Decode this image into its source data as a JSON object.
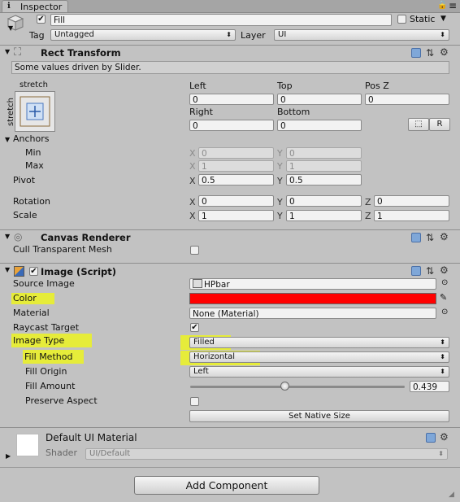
{
  "tab": {
    "label": "Inspector"
  },
  "gameobject": {
    "active": true,
    "name": "Fill",
    "static_label": "Static",
    "tag_label": "Tag",
    "tag_value": "Untagged",
    "layer_label": "Layer",
    "layer_value": "UI"
  },
  "rect_transform": {
    "title": "Rect Transform",
    "driven_note": "Some values driven by Slider.",
    "anchor_preset_top": "stretch",
    "anchor_preset_side": "stretch",
    "left_label": "Left",
    "left_value": "0",
    "top_label": "Top",
    "top_value": "0",
    "posz_label": "Pos Z",
    "posz_value": "0",
    "right_label": "Right",
    "right_value": "0",
    "bottom_label": "Bottom",
    "bottom_value": "0",
    "r_button": "R",
    "anchors_label": "Anchors",
    "min_label": "Min",
    "min_x": "0",
    "min_y": "0",
    "max_label": "Max",
    "max_x": "1",
    "max_y": "1",
    "pivot_label": "Pivot",
    "pivot_x": "0.5",
    "pivot_y": "0.5",
    "rotation_label": "Rotation",
    "rot_x": "0",
    "rot_y": "0",
    "rot_z": "0",
    "scale_label": "Scale",
    "scale_x": "1",
    "scale_y": "1",
    "scale_z": "1",
    "axis_x": "X",
    "axis_y": "Y",
    "axis_z": "Z"
  },
  "canvas_renderer": {
    "title": "Canvas Renderer",
    "cull_label": "Cull Transparent Mesh",
    "cull_checked": false
  },
  "image_script": {
    "title": "Image (Script)",
    "source_label": "Source Image",
    "source_value": "HPbar",
    "color_label": "Color",
    "color_value": "#ff0000",
    "material_label": "Material",
    "material_value": "None (Material)",
    "raycast_label": "Raycast Target",
    "raycast_checked": true,
    "image_type_label": "Image Type",
    "image_type_value": "Filled",
    "fill_method_label": "Fill Method",
    "fill_method_value": "Horizontal",
    "fill_origin_label": "Fill Origin",
    "fill_origin_value": "Left",
    "fill_amount_label": "Fill Amount",
    "fill_amount_value": "0.439",
    "fill_amount": 0.439,
    "preserve_label": "Preserve Aspect",
    "preserve_checked": false,
    "native_size_button": "Set Native Size"
  },
  "material_panel": {
    "name": "Default UI Material",
    "shader_label": "Shader",
    "shader_value": "UI/Default"
  },
  "add_component": {
    "label": "Add Component"
  },
  "colors": {
    "highlight": "#e6ec3a",
    "panel": "#c2c2c2",
    "field": "#f2f2f2"
  }
}
